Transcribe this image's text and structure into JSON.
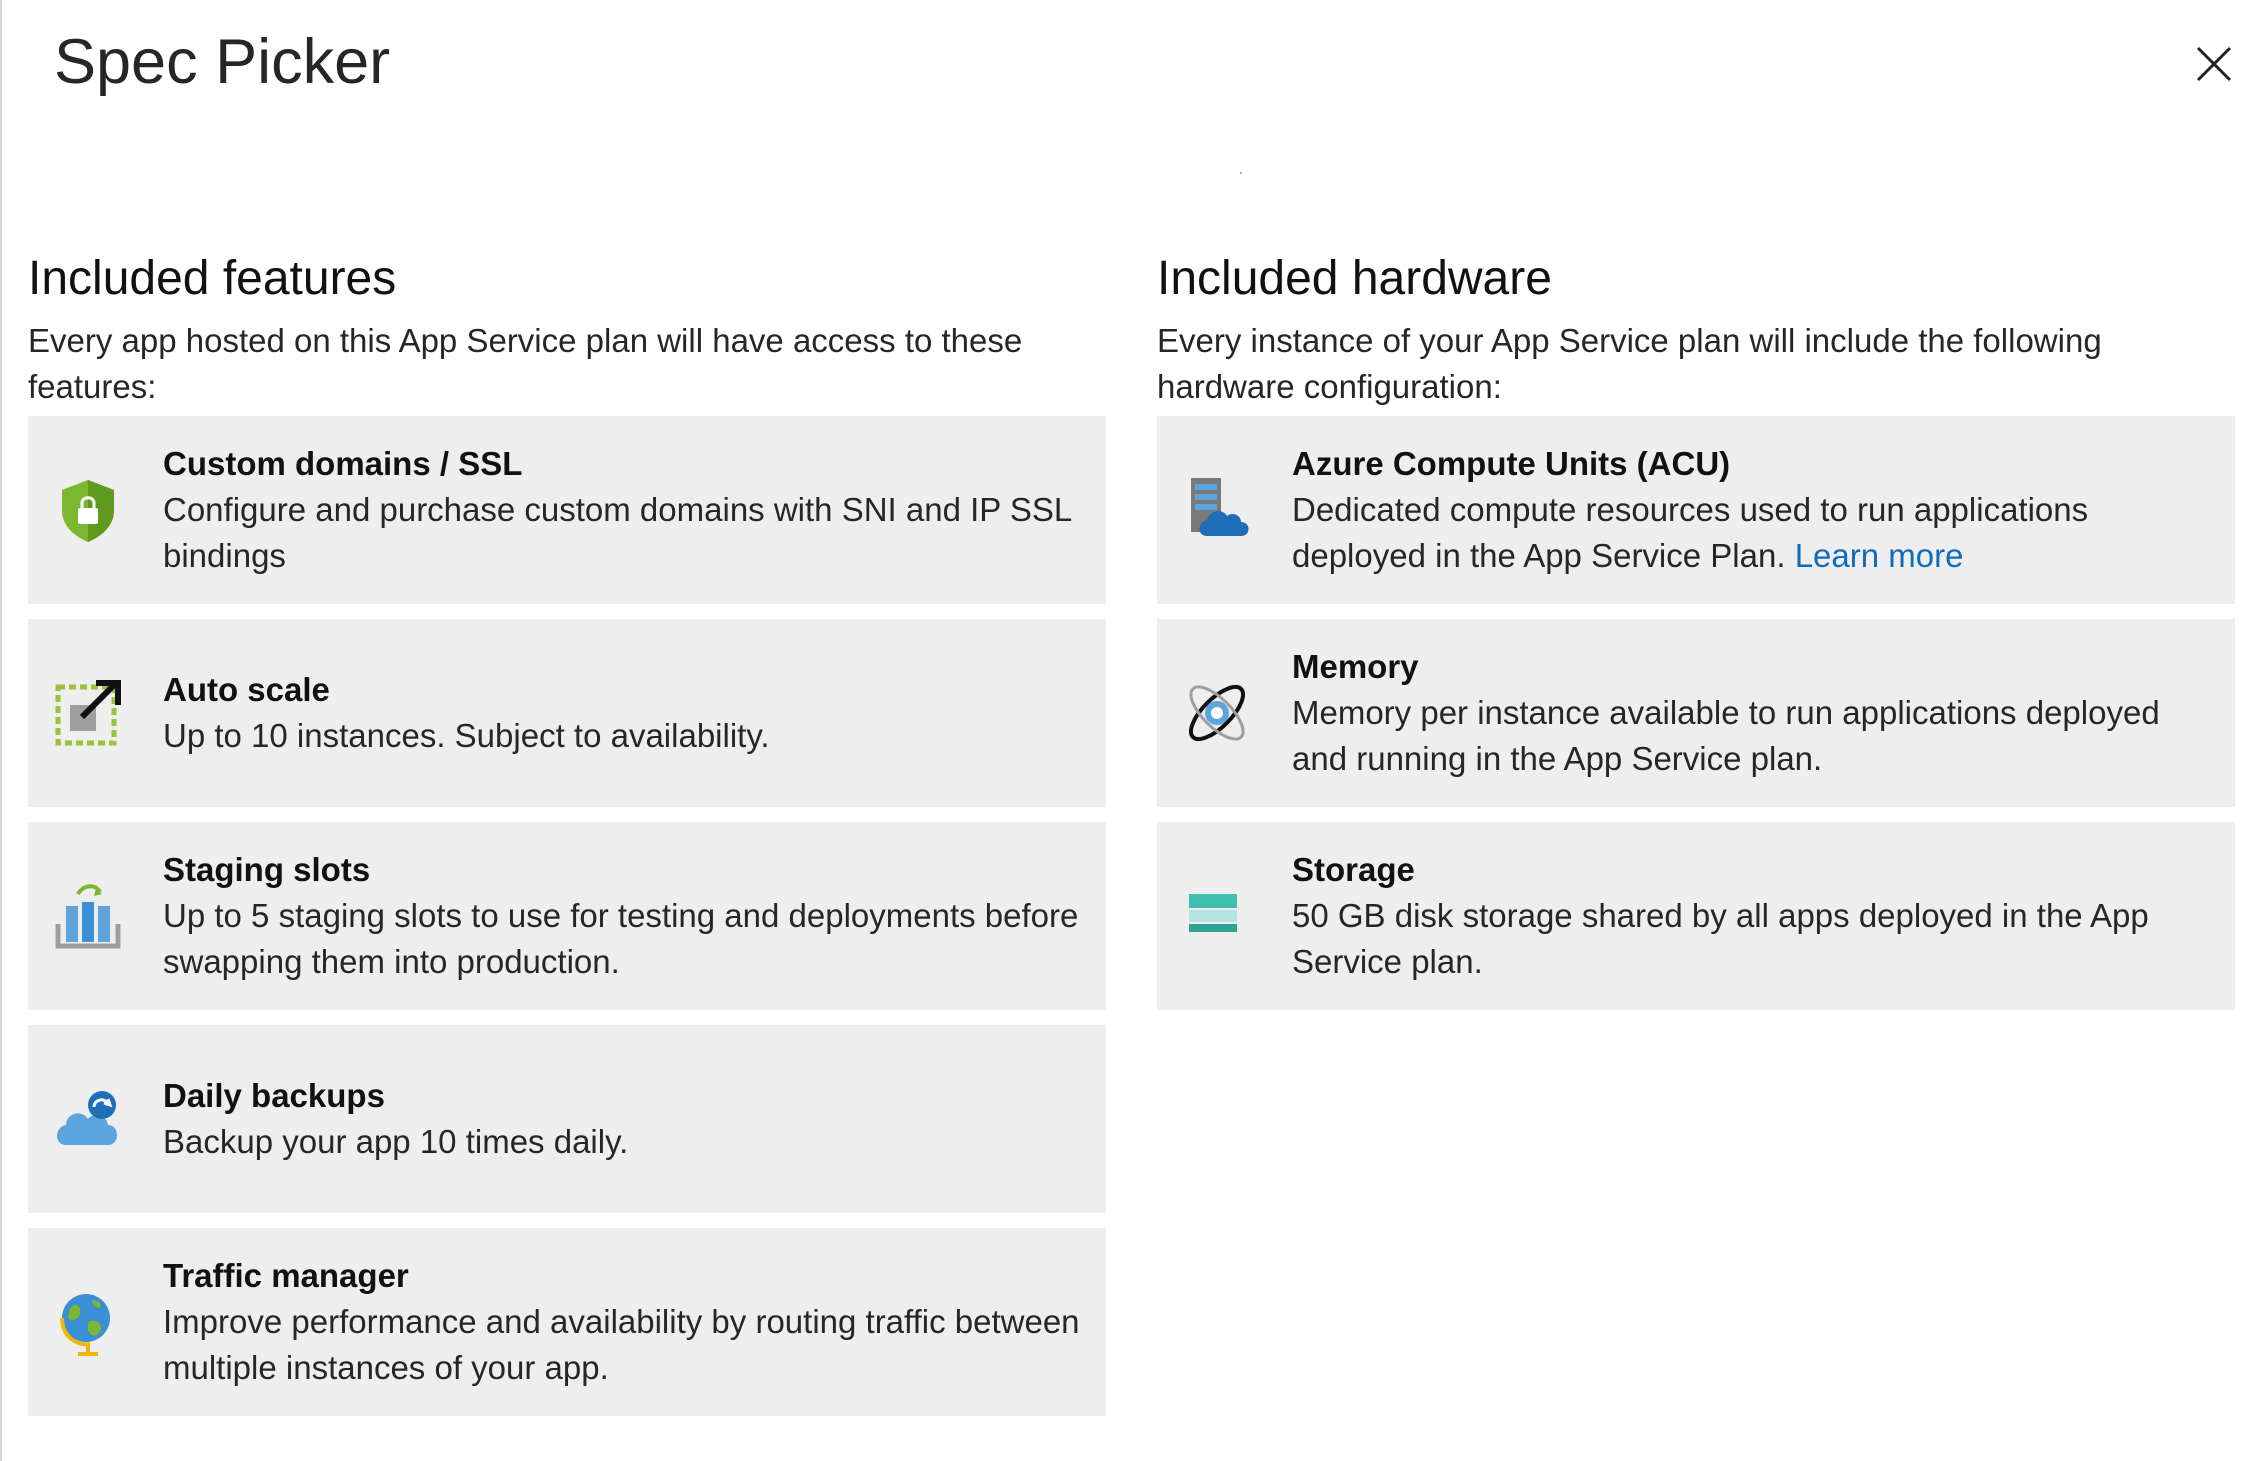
{
  "header": {
    "title": "Spec Picker",
    "close_icon": "close-icon"
  },
  "features": {
    "title": "Included features",
    "description": "Every app hosted on this App Service plan will have access to these features:",
    "items": [
      {
        "icon": "shield-lock-icon",
        "title": "Custom domains / SSL",
        "description": "Configure and purchase custom domains with SNI and IP SSL bindings"
      },
      {
        "icon": "autoscale-icon",
        "title": "Auto scale",
        "description": "Up to 10 instances. Subject to availability."
      },
      {
        "icon": "staging-slots-icon",
        "title": "Staging slots",
        "description": "Up to 5 staging slots to use for testing and deployments before swapping them into production."
      },
      {
        "icon": "cloud-backup-icon",
        "title": "Daily backups",
        "description": "Backup your app 10 times daily."
      },
      {
        "icon": "globe-icon",
        "title": "Traffic manager",
        "description": "Improve performance and availability by routing traffic between multiple instances of your app."
      }
    ]
  },
  "hardware": {
    "title": "Included hardware",
    "description": "Every instance of your App Service plan will include the following hardware configuration:",
    "items": [
      {
        "icon": "server-cloud-icon",
        "title": "Azure Compute Units (ACU)",
        "description": "Dedicated compute resources used to run applications deployed in the App Service Plan.",
        "link": "Learn more"
      },
      {
        "icon": "memory-orbit-icon",
        "title": "Memory",
        "description": "Memory per instance available to run applications deployed and running in the App Service plan."
      },
      {
        "icon": "storage-icon",
        "title": "Storage",
        "description": "50 GB disk storage shared by all apps deployed in the App Service plan."
      }
    ]
  },
  "colors": {
    "card_background": "#eeeeee",
    "link": "#0f6cbd",
    "shield_green": "#7cb82f",
    "azure_blue": "#1e90ff"
  }
}
